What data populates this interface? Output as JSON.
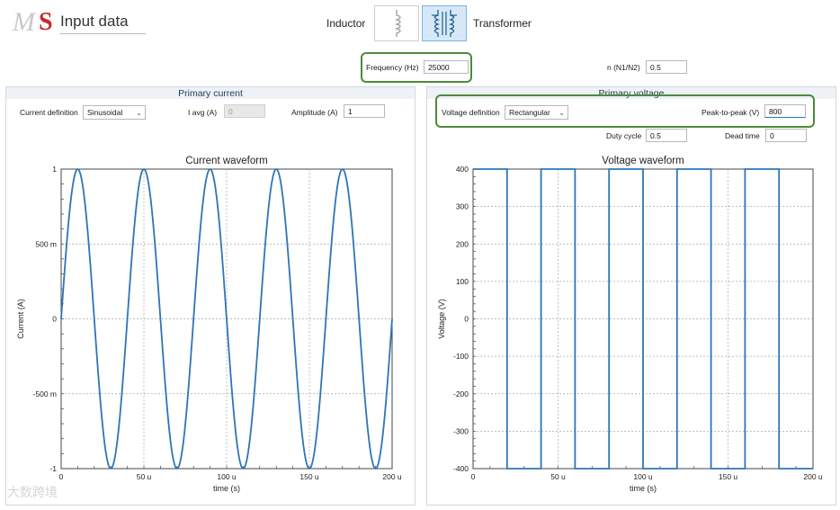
{
  "header": {
    "title": "Input data",
    "logo_text": "MS",
    "inductor_label": "Inductor",
    "transformer_label": "Transformer",
    "selected_component": "Transformer"
  },
  "frequency": {
    "label": "Frequency (Hz)",
    "value": "25000"
  },
  "turns_ratio": {
    "label": "n (N1/N2)",
    "value": "0.5"
  },
  "primary_current": {
    "panel_title": "Primary current",
    "definition_label": "Current definition",
    "definition_value": "Sinusoidal",
    "iavg_label": "I avg (A)",
    "iavg_value": "0",
    "amplitude_label": "Amplitude (A)",
    "amplitude_value": "1"
  },
  "primary_voltage": {
    "panel_title": "Primary voltage",
    "definition_label": "Voltage definition",
    "definition_value": "Rectangular",
    "ptp_label": "Peak-to-peak (V)",
    "ptp_value": "800",
    "duty_label": "Duty cycle",
    "duty_value": "0.5",
    "dead_label": "Dead time",
    "dead_value": "0"
  },
  "watermark": "大数跨境",
  "colors": {
    "line": "#2e75b6",
    "highlight": "#4e8a3a",
    "panel_head": "#eef2f7"
  },
  "chart_data": [
    {
      "type": "line",
      "title": "Current waveform",
      "xlabel": "time (s)",
      "ylabel": "Current (A)",
      "xlim": [
        0,
        200
      ],
      "ylim": [
        -1,
        1
      ],
      "x_ticks": [
        "0",
        "50 u",
        "100 u",
        "150 u",
        "200 u"
      ],
      "y_ticks": [
        "1",
        "500 m",
        "0",
        "-500 m",
        "-1"
      ],
      "grid": true,
      "series": [
        {
          "waveform": "sine",
          "amplitude": 1,
          "period": 40,
          "x_unit": "us",
          "x_range": [
            0,
            200
          ]
        }
      ]
    },
    {
      "type": "line",
      "title": "Voltage waveform",
      "xlabel": "time (s)",
      "ylabel": "Voltage (V)",
      "xlim": [
        0,
        200
      ],
      "ylim": [
        -400,
        400
      ],
      "x_ticks": [
        "0",
        "50 u",
        "100 u",
        "150 u",
        "200 u"
      ],
      "y_ticks": [
        "400",
        "300",
        "200",
        "100",
        "0",
        "-100",
        "-200",
        "-300",
        "-400"
      ],
      "grid": true,
      "series": [
        {
          "waveform": "square",
          "high": 400,
          "low": -400,
          "period": 40,
          "x_unit": "us",
          "x_range": [
            0,
            200
          ]
        }
      ]
    }
  ]
}
